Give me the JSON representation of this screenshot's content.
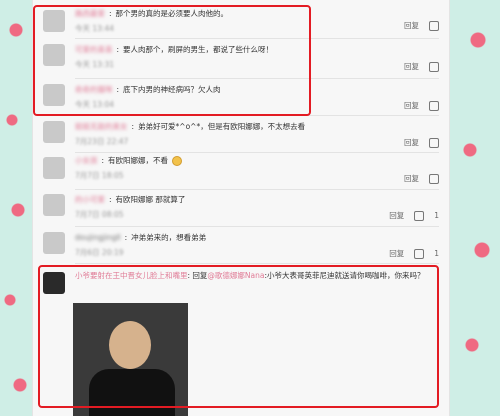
{
  "comments": [
    {
      "user": "路西最爱",
      "text": "那个男的真的是必须要人肉他的。",
      "time": "今天 13:44",
      "reply_label": "回复"
    },
    {
      "user": "可爱的喜喜",
      "text": "要人肉那个，刷屏的男生，都说了些什么呀！",
      "time": "今天 13:31",
      "reply_label": "回复"
    },
    {
      "user": "奇奇的猫咪",
      "text": "底下内男的神经病吗？欠人肉",
      "time": "今天 13:04",
      "reply_label": "回复"
    },
    {
      "user": "姐姐无敌的美女",
      "text": "弟弟好可爱*^o^*，但是有欧阳娜娜，不太想去看",
      "time": "7月23日 22:47",
      "reply_label": "回复"
    },
    {
      "user": "小女孩",
      "text": "有欧阳娜娜，不看",
      "time": "7月7日 18:05",
      "reply_label": "回复"
    },
    {
      "user": "的小可爱",
      "text": "有欧阳娜娜 那就算了",
      "time": "7月7日 08:05",
      "reply_label": "回复",
      "likes": "1"
    },
    {
      "user": "doujingjingll",
      "text": "冲弟弟来的，想看弟弟",
      "time": "7月6日 20:19",
      "reply_label": "回复",
      "likes": "1"
    }
  ],
  "last_comment": {
    "user": "小爷要射在王中晋女儿脸上和嘴里",
    "reply_prefix": "回复",
    "mention": "@歌德娜娜Nana",
    "text": ":小爷大表哥英菲尼迪就送请你喝咖啡，你来吗？"
  },
  "colors": {
    "highlight": "#e31b23",
    "username": "#e07b96",
    "panel_bg": "#f7f7f7"
  }
}
